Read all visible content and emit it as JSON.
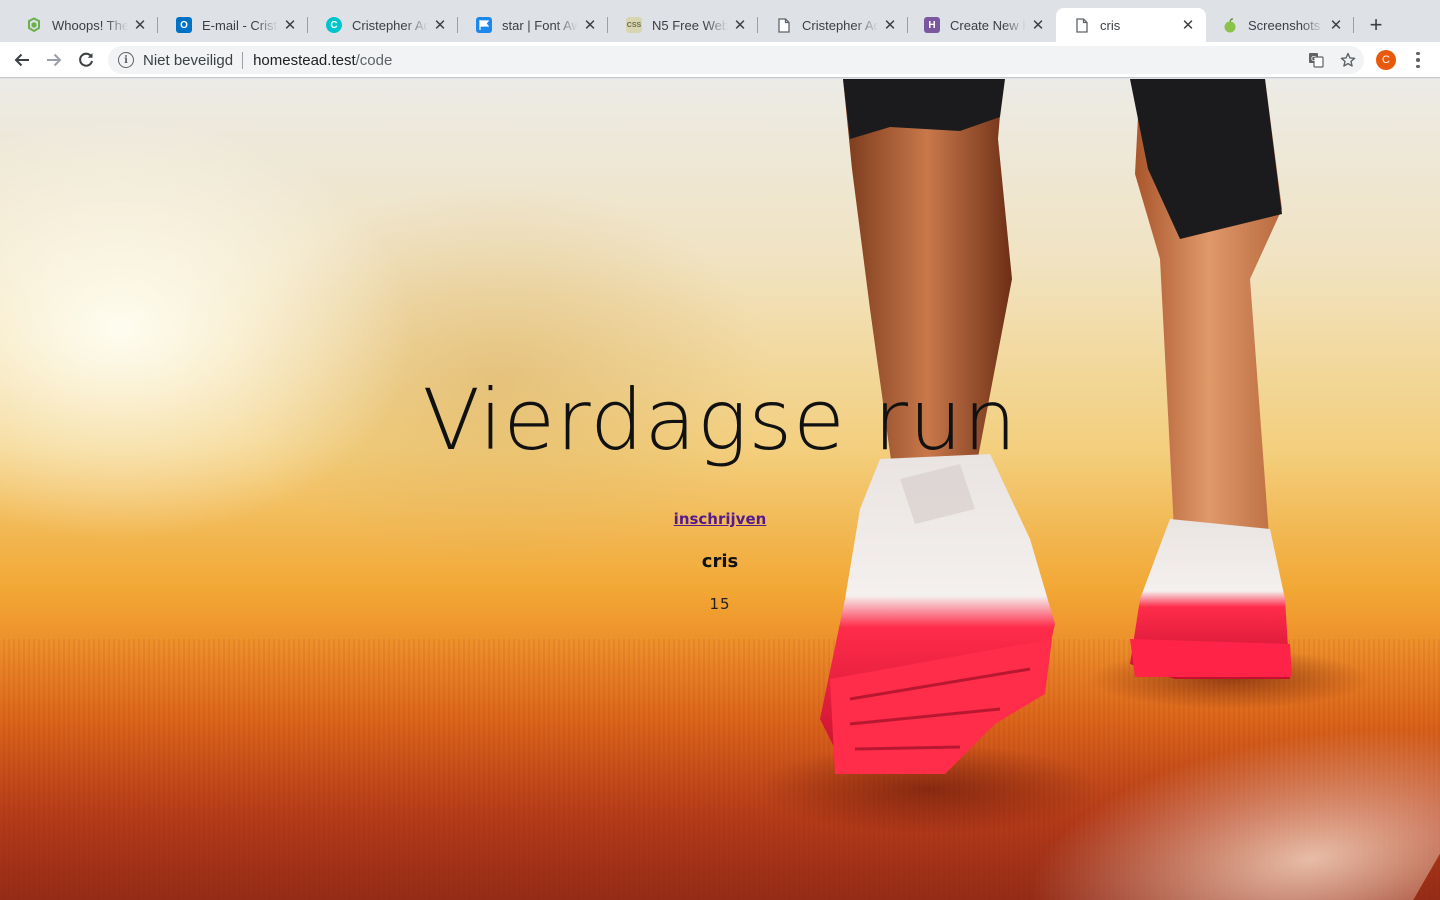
{
  "browser": {
    "tabs": [
      {
        "title": "Whoops! There was an error.",
        "icon": "laravel-icon",
        "color": "#6ab04c"
      },
      {
        "title": "E-mail - Cristepher",
        "icon": "outlook-icon",
        "color": "#0072c6"
      },
      {
        "title": "Cristepher Adames",
        "icon": "c-circle-icon",
        "color": "#00c4cc"
      },
      {
        "title": "star | Font Awesome",
        "icon": "flag-icon",
        "color": "#1c88ed"
      },
      {
        "title": "N5 Free Website",
        "icon": "css-icon",
        "color": "#b7b58a"
      },
      {
        "title": "Cristepher Adames",
        "icon": "page-icon",
        "color": "#5f6368"
      },
      {
        "title": "Create New Pipeline",
        "icon": "heroku-icon",
        "color": "#79589f"
      },
      {
        "title": "cris",
        "icon": "page-icon",
        "color": "#5f6368",
        "active": true
      },
      {
        "title": "Screenshots maken",
        "icon": "apple-icon",
        "color": "#8bc34a"
      }
    ],
    "security_label": "Niet beveiligd",
    "url_host": "homestead.test",
    "url_path": "/code",
    "profile_initial": "C",
    "profile_color": "#e8590c"
  },
  "page": {
    "title": "Vierdagse run",
    "signup_link": "inschrijven",
    "user_name": "cris",
    "number": "15"
  }
}
